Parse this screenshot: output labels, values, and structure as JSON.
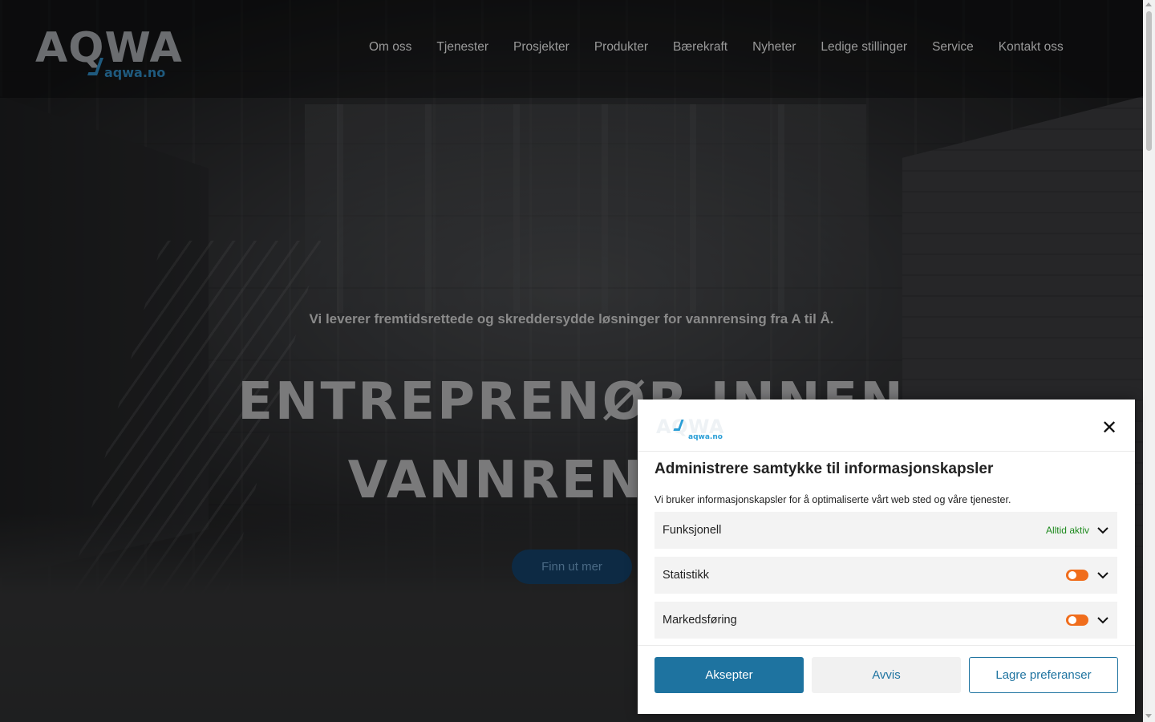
{
  "site": {
    "logo_text": "AQWA",
    "logo_sub": "aqwa.no"
  },
  "nav": {
    "items": [
      {
        "label": "Om oss"
      },
      {
        "label": "Tjenester"
      },
      {
        "label": "Prosjekter"
      },
      {
        "label": "Produkter"
      },
      {
        "label": "Bærekraft"
      },
      {
        "label": "Nyheter"
      },
      {
        "label": "Ledige stillinger"
      },
      {
        "label": "Service"
      },
      {
        "label": "Kontakt oss"
      }
    ]
  },
  "hero": {
    "tagline": "Vi leverer fremtidsrettede og skreddersydde løsninger for vannrensing fra A til Å.",
    "headline_line1": "ENTREPRENØR INNEN",
    "headline_line2": "VANNRENSING",
    "cta_label": "Finn ut mer"
  },
  "consent": {
    "logo_text": "AQWA",
    "logo_sub": "aqwa.no",
    "close_icon": "close-icon",
    "title": "Administrere samtykke til informasjonskapsler",
    "description": "Vi bruker informasjonskapsler for å optimaliserte vårt web sted og våre tjenester.",
    "categories": [
      {
        "label": "Funksjonell",
        "status": "Alltid aktiv"
      },
      {
        "label": "Statistikk",
        "enabled": false
      },
      {
        "label": "Markedsføring",
        "enabled": false
      }
    ],
    "buttons": {
      "accept": "Aksepter",
      "deny": "Avvis",
      "save": "Lagre preferanser"
    },
    "colors": {
      "accent": "#1e73a0",
      "toggle": "#f06d1c",
      "always_active": "#1e8a1e"
    }
  }
}
